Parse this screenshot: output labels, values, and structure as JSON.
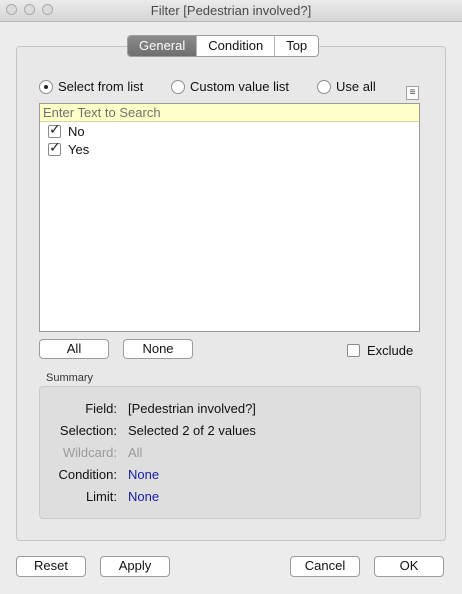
{
  "window": {
    "title": "Filter [Pedestrian involved?]"
  },
  "tabs": [
    {
      "label": "General",
      "active": true
    },
    {
      "label": "Condition",
      "active": false
    },
    {
      "label": "Top",
      "active": false
    }
  ],
  "options": {
    "select_from_list": "Select from list",
    "custom_value_list": "Custom value list",
    "use_all": "Use all",
    "selected": "select_from_list"
  },
  "list": {
    "search_placeholder": "Enter Text to Search",
    "items": [
      {
        "label": "No",
        "checked": true
      },
      {
        "label": "Yes",
        "checked": true
      }
    ]
  },
  "list_buttons": {
    "all": "All",
    "none": "None",
    "exclude": "Exclude"
  },
  "summary": {
    "heading": "Summary",
    "field_key": "Field:",
    "field_value": "[Pedestrian involved?]",
    "selection_key": "Selection:",
    "selection_value": "Selected 2 of 2 values",
    "wildcard_key": "Wildcard:",
    "wildcard_value": "All",
    "condition_key": "Condition:",
    "condition_value": "None",
    "limit_key": "Limit:",
    "limit_value": "None"
  },
  "footer": {
    "reset": "Reset",
    "apply": "Apply",
    "cancel": "Cancel",
    "ok": "OK"
  }
}
